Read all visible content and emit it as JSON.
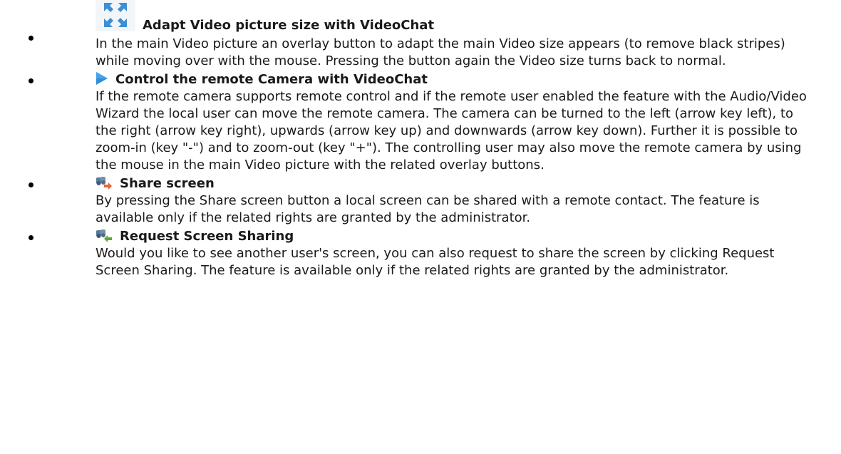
{
  "items": [
    {
      "icon": "expand-arrows-icon",
      "title": "Adapt Video picture size with VideoChat",
      "description": "In the main Video picture an overlay button to adapt the main Video size appears (to remove black stripes) while moving over with the mouse. Pressing the button again the Video size turns back to normal."
    },
    {
      "icon": "play-triangle-icon",
      "title": "Control the remote Camera with VideoChat",
      "description": "If the remote camera supports remote control and if the remote user enabled the feature with the Audio/Video Wizard the local user can move the remote camera. The camera can be turned to the left (arrow key left), to the right (arrow key right), upwards (arrow key up) and downwards (arrow key down). Further it is possible to zoom-in (key \"-\") and to zoom-out (key \"+\"). The controlling user may also move the remote camera by using the mouse in the main Video picture with the related overlay buttons."
    },
    {
      "icon": "share-screen-icon",
      "title": "Share screen",
      "description": "By pressing the Share screen button a local screen can be shared with a remote contact. The feature is available only if the related rights are granted by the administrator."
    },
    {
      "icon": "request-screen-sharing-icon",
      "title": "Request Screen Sharing",
      "description": "Would you like to see another user's screen, you can also request to share the screen by clicking Request Screen Sharing. The feature is available only if the related rights are granted by the administrator."
    }
  ],
  "colors": {
    "accent_blue": "#2f8fd8",
    "arrow_orange": "#e8643c",
    "arrow_green": "#5aa83a"
  }
}
